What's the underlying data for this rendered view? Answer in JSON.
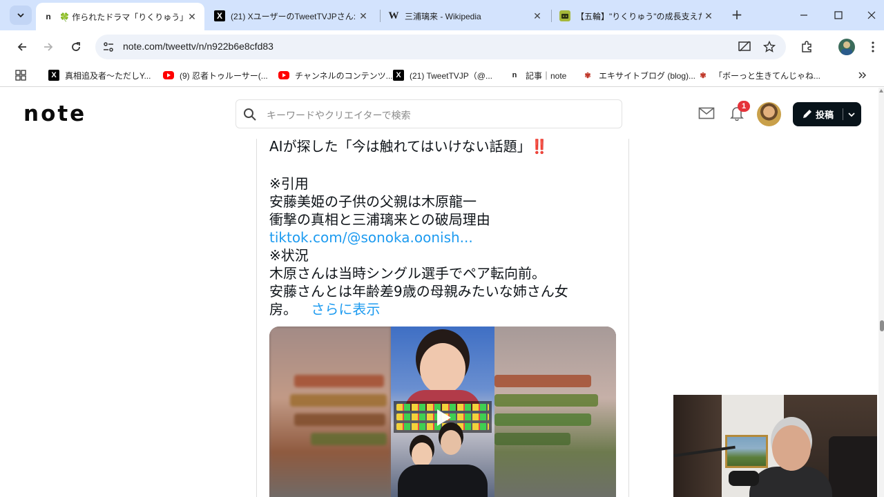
{
  "browser": {
    "tabs": [
      {
        "title": "🍀 作られたドラマ「りくりゅう」:",
        "favicon": "n",
        "active": true
      },
      {
        "title": "(21) XユーザーのTweetTVJPさん: ",
        "favicon": "X",
        "active": false
      },
      {
        "title": "三浦璃来 - Wikipedia",
        "favicon": "W",
        "active": false
      },
      {
        "title": "【五輪】\"りくりゅう\"の成長支えた陰",
        "favicon": "niconico",
        "active": false
      }
    ],
    "url": "note.com/tweettv/n/n922b6e8cfd83",
    "bookmarks": [
      {
        "label": "真相追及者〜ただしY...",
        "icon": "x-logo"
      },
      {
        "label": "(9) 忍者トゥルーサー(...",
        "icon": "youtube-logo"
      },
      {
        "label": "チャンネルのコンテンツ...",
        "icon": "youtube-logo"
      },
      {
        "label": "(21) TweetTVJP（@...",
        "icon": "x-logo"
      },
      {
        "label": "記事｜note",
        "icon": "note-logo"
      },
      {
        "label": "エキサイトブログ (blog)...",
        "icon": "paw-logo"
      },
      {
        "label": "「ボーっと生きてんじゃね...",
        "icon": "paw-logo"
      }
    ]
  },
  "note": {
    "logo": "note",
    "search_placeholder": "キーワードやクリエイターで検索",
    "notification_count": "1",
    "post_label": "投稿"
  },
  "tweet": {
    "line1": "AIが探した「今は触れてはいけない話題」",
    "line1_emoji": "‼️",
    "line2": "※引用",
    "line3": "安藤美姫の子供の父親は木原龍一",
    "line4": "衝撃の真相と三浦璃来との破局理由",
    "link": "tiktok.com/@sonoka.oonish...",
    "line5": "※状況",
    "line6": "木原さんは当時シングル選手でペア転向前。",
    "line7": "安藤さんとは年齢差9歳の母親みたいな姉さん女",
    "line8": "房。",
    "show_more": "さらに表示"
  },
  "colors": {
    "tabstrip_bg": "#d3e3fd",
    "link_blue": "#1d9bf0",
    "post_button_bg": "#08131a",
    "badge_red": "#e5333a"
  }
}
